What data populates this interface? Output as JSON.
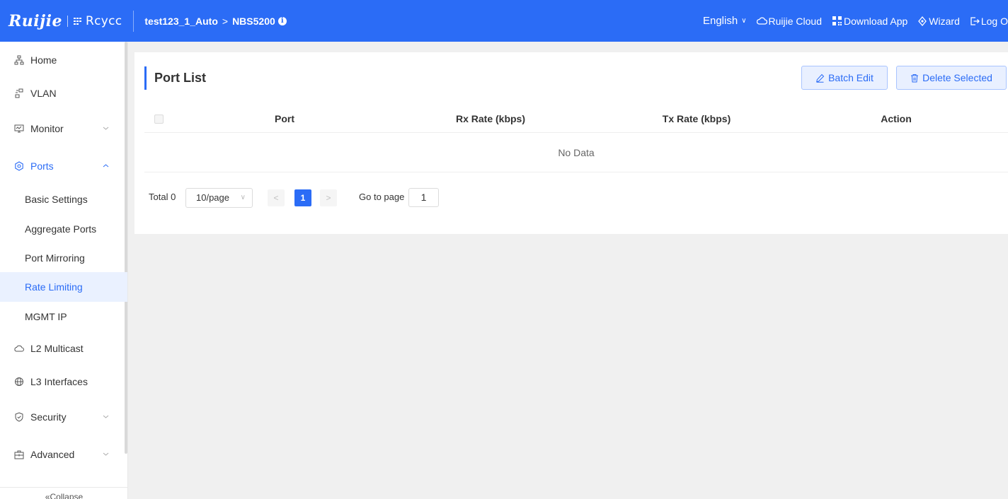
{
  "header": {
    "brand_ruijie": "Ruijie",
    "brand_reyee": "Rcycc",
    "project": "test123_1_Auto",
    "breadcrumb_sep": ">",
    "device": "NBS5200",
    "info_glyph": "i",
    "nav": {
      "language": "English",
      "cloud": "Ruijie Cloud",
      "download": "Download App",
      "wizard": "Wizard",
      "logout": "Log O"
    }
  },
  "sidebar": {
    "items": [
      {
        "label": "Home",
        "icon": "sitemap-icon"
      },
      {
        "label": "VLAN",
        "icon": "vlan-icon"
      },
      {
        "label": "Monitor",
        "icon": "monitor-icon",
        "expandable": true
      },
      {
        "label": "Ports",
        "icon": "ports-icon",
        "expanded": true
      },
      {
        "label": "L2 Multicast",
        "icon": "cloud-icon"
      },
      {
        "label": "L3 Interfaces",
        "icon": "globe-icon"
      },
      {
        "label": "Security",
        "icon": "shield-icon",
        "expandable": true
      },
      {
        "label": "Advanced",
        "icon": "briefcase-icon",
        "expandable": true
      }
    ],
    "ports_submenu": [
      "Basic Settings",
      "Aggregate Ports",
      "Port Mirroring",
      "Rate Limiting",
      "MGMT IP"
    ],
    "active_submenu": "Rate Limiting",
    "collapse_label": "Collapse"
  },
  "main": {
    "title": "Port List",
    "batch_edit_label": "Batch Edit",
    "delete_selected_label": "Delete Selected",
    "table": {
      "columns": [
        "Port",
        "Rx Rate (kbps)",
        "Tx Rate (kbps)",
        "Action"
      ],
      "empty_text": "No Data"
    },
    "pagination": {
      "total_label": "Total 0",
      "page_size": "10/page",
      "current_page": "1",
      "goto_label": "Go to page",
      "goto_value": "1"
    }
  },
  "colors": {
    "accent": "#2b6cf6",
    "active_bg": "#eaf1ff"
  }
}
